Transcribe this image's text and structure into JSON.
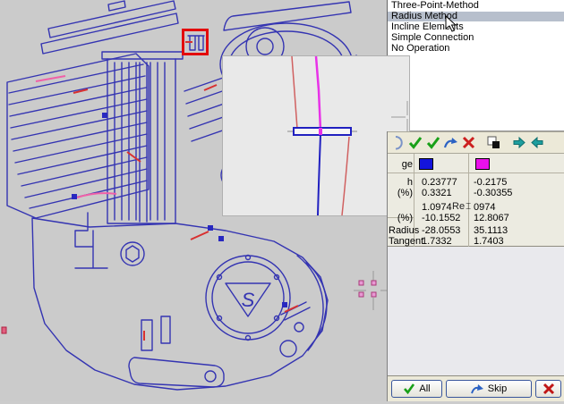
{
  "method_list": {
    "items": [
      "Three-Point-Method",
      "Radius Method",
      "Incline Elements",
      "Simple Connection",
      "No Operation"
    ],
    "selected": "Radius Method",
    "selected_index": 1
  },
  "toolbar": {
    "icons": [
      "half-circle-icon",
      "accept-check-icon",
      "accept-all-check-icon",
      "skip-curve-arrow-icon",
      "delete-x-icon",
      "swap-colors-icon",
      "step-forward-icon",
      "step-back-icon"
    ]
  },
  "comparison_table": {
    "header_label_fragment": "ge",
    "element_colors": {
      "col1": "#1414dc",
      "col2": "#ea10ea"
    },
    "rows": [
      {
        "label": "h",
        "col1": "0.23777",
        "col2": "-0.2175"
      },
      {
        "label": "(%)",
        "col1": "0.3321",
        "col2": "-0.30355"
      },
      {
        "label": "",
        "col1": "1.0974",
        "col2": "0974",
        "overlay_text": "Re"
      },
      {
        "label": "(%)",
        "col1": "-10.1552",
        "col2": "12.8067"
      },
      {
        "label": "Radius",
        "col1": "-28.0553",
        "col2": "35.1113"
      },
      {
        "label": "Tangent",
        "col1": "1.7332",
        "col2": "1.7403"
      }
    ]
  },
  "action_bar": {
    "all_label": "All",
    "skip_label": "Skip"
  },
  "canvas": {
    "logo_letter": "S"
  },
  "colors": {
    "vector_blue": "#3434b2",
    "accent_red": "#d83030",
    "accent_pink": "#f060a8",
    "selection_highlight": "#e30b0b",
    "list_selected_bg": "#b7bfcc"
  }
}
